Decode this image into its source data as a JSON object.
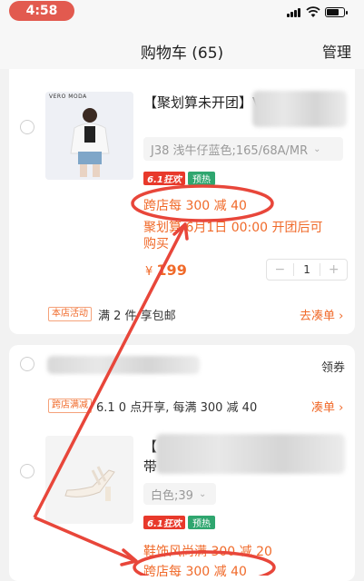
{
  "status_bar": {
    "time": "4:58"
  },
  "header": {
    "title": "购物车 (65)",
    "manage": "管理"
  },
  "item1": {
    "title": "【聚划算未开团】V",
    "brand_logo": "VERO MODA",
    "sku": "J38 浅牛仔蓝色;165/68A/MR",
    "tag_61": "6.1狂欢",
    "tag_hot": "预热",
    "promo_cross_store": "跨店每 300 减 40",
    "promo_juhuasuan_line1": "聚划算 6月1日 00:00 开团后可",
    "promo_juhuasuan_line2": "购买",
    "price_symbol": "¥",
    "price_value": "199",
    "qty": "1",
    "qty_minus": "−",
    "qty_plus": "+"
  },
  "store_activity": {
    "tag": "本店活动",
    "text": "满 2 件 享包邮",
    "link": "去凑单 ›"
  },
  "store2": {
    "coupon": "领券",
    "cross_tag": "跨店满减",
    "cross_text": "6.1 0 点开享, 每满 300 减 40",
    "link": "凑单 ›"
  },
  "item2": {
    "title_line1": "【",
    "title_line2": "带",
    "sku": "白色;39",
    "tag_61": "6.1狂欢",
    "tag_hot": "预热",
    "promo_store": "鞋饰风尚满 300 减 20",
    "promo_cross_store": "跨店每 300 减 40"
  },
  "colors": {
    "accent_orange": "#f06a2a",
    "time_pill": "#e25a4f",
    "annotation_red": "#e8463a"
  }
}
